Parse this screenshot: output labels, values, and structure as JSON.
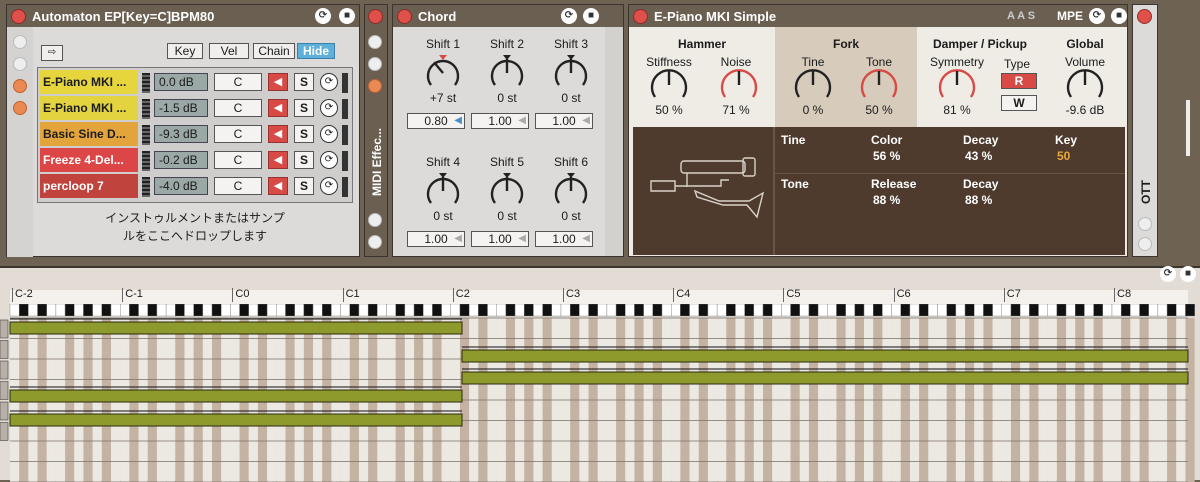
{
  "rack": {
    "title": "Automaton  EP[Key=C]BPM80",
    "buttons": [
      "Key",
      "Vel",
      "Chain",
      "Hide"
    ],
    "chains": [
      {
        "name": "E-Piano MKI ...",
        "vol": "0.0 dB",
        "key": "C",
        "color": "#e7d53e"
      },
      {
        "name": "E-Piano MKI ...",
        "vol": "-1.5 dB",
        "key": "C",
        "color": "#e3d33f"
      },
      {
        "name": "Basic Sine D...",
        "vol": "-9.3 dB",
        "key": "C",
        "color": "#e4a43c"
      },
      {
        "name": "Freeze 4-Del...",
        "vol": "-0.2 dB",
        "key": "C",
        "color": "#dd4646"
      },
      {
        "name": "percloop 7",
        "vol": "-4.0 dB",
        "key": "C",
        "color": "#c0443d"
      }
    ],
    "solo": "S",
    "drop1": "インストゥルメントまたはサンプ",
    "drop2": "ルをここへドロップします"
  },
  "midi_effects": {
    "label": "MIDI Effec..."
  },
  "chord": {
    "title": "Chord",
    "knobs": [
      {
        "label": "Shift 1",
        "value": "+7 st",
        "box": "0.80"
      },
      {
        "label": "Shift 2",
        "value": "0 st",
        "box": "1.00"
      },
      {
        "label": "Shift 3",
        "value": "0 st",
        "box": "1.00"
      },
      {
        "label": "Shift 4",
        "value": "0 st",
        "box": "1.00"
      },
      {
        "label": "Shift 5",
        "value": "0 st",
        "box": "1.00"
      },
      {
        "label": "Shift 6",
        "value": "0 st",
        "box": "1.00"
      }
    ]
  },
  "epiano": {
    "title": "E-Piano MKI Simple",
    "aas": "A A S",
    "mpe": "MPE",
    "hammer": {
      "title": "Hammer",
      "stiffness_label": "Stiffness",
      "stiffness": "50 %",
      "noise_label": "Noise",
      "noise": "71 %"
    },
    "fork": {
      "title": "Fork",
      "tine_label": "Tine",
      "tine": "0 %",
      "tone_label": "Tone",
      "tone": "50 %"
    },
    "damper": {
      "title": "Damper / Pickup",
      "sym_label": "Symmetry",
      "sym": "81 %",
      "type_label": "Type",
      "r": "R",
      "w": "W"
    },
    "global": {
      "title": "Global",
      "vol_label": "Volume",
      "vol": "-9.6 dB"
    },
    "panel": {
      "tine": "Tine",
      "color_label": "Color",
      "color": "56 %",
      "decay1_label": "Decay",
      "decay1": "43 %",
      "key_label": "Key",
      "key": "50",
      "tone": "Tone",
      "release_label": "Release",
      "release": "88 %",
      "decay2_label": "Decay",
      "decay2": "88 %"
    }
  },
  "ott": {
    "label": "OTT"
  },
  "roll": {
    "octaves": [
      "C-2",
      "C-1",
      "C0",
      "C1",
      "C2",
      "C3",
      "C4",
      "C5",
      "C6",
      "C7",
      "C8"
    ]
  }
}
